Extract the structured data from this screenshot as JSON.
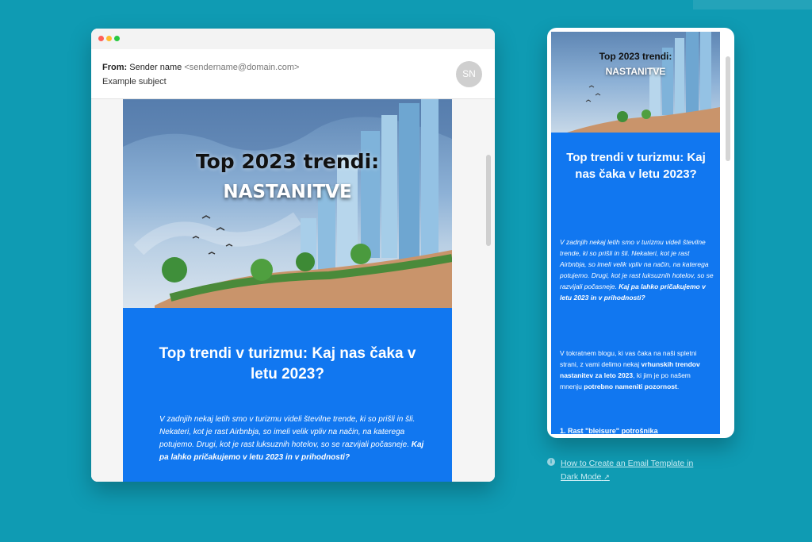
{
  "desktop": {
    "from_label": "From:",
    "sender_name": "Sender name",
    "sender_email": "<sendername@domain.com>",
    "subject": "Example subject",
    "avatar_initials": "SN",
    "hero_title_line1": "Top 2023 trendi:",
    "hero_title_line2": "NASTANITVE",
    "article_title": "Top trendi v turizmu: Kaj nas čaka v letu 2023?",
    "intro_text": "V zadnjih nekaj letih smo v turizmu videli številne trende, ki so prišli in šli. Nekateri, kot je rast Airbnbja, so imeli velik vpliv na način, na katerega potujemo. Drugi, kot je rast luksuznih hotelov, so se razvijali počasneje.",
    "intro_bold": "Kaj pa lahko pričakujemo v letu 2023 in v prihodnosti?"
  },
  "mobile": {
    "hero_title_line1": "Top 2023 trendi:",
    "hero_title_line2": "NASTANITVE",
    "article_title": "Top trendi v turizmu: Kaj nas čaka v letu 2023?",
    "para1_text": "V zadnjih nekaj letih smo v turizmu videli številne trende, ki so prišli in šli. Nekateri, kot je rast Airbnbja, so imeli velik vpliv na način, na katerega potujemo. Drugi, kot je rast luksuznih hotelov, so se razvijali počasneje.",
    "para1_bold": "Kaj pa lahko pričakujemo v letu 2023 in v prihodnosti?",
    "para2_a": "V tokratnem blogu, ki vas čaka na naši spletni strani, z vami delimo nekaj",
    "para2_b": "vrhunskih trendov nastanitev za leto 2023",
    "para2_c": ", ki jim je po našem mnenju",
    "para2_d": "potrebno nameniti pozornost",
    "para2_e": ".",
    "section_heading": "1. Rast \"bleisure\" potrošnika"
  },
  "help": {
    "link_text": "How to Create an Email Template in Dark Mode",
    "info_icon": "info-icon",
    "external_icon": "external-link-icon"
  },
  "colors": {
    "background": "#0f9bb3",
    "email_blue": "#1177f0"
  }
}
